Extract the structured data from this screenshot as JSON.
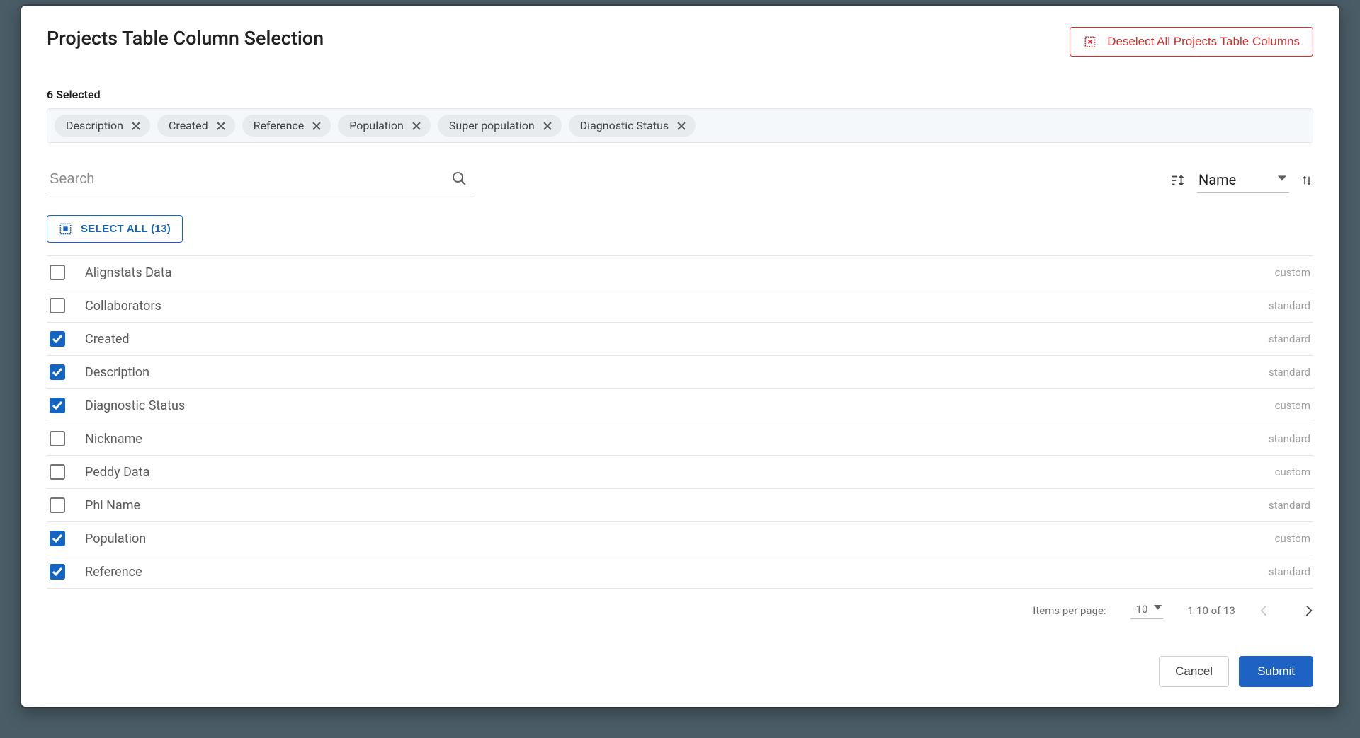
{
  "header": {
    "title": "Projects Table Column Selection",
    "deselect_label": "Deselect All Projects Table Columns"
  },
  "selected": {
    "summary": "6 Selected",
    "chips": [
      "Description",
      "Created",
      "Reference",
      "Population",
      "Super population",
      "Diagnostic Status"
    ]
  },
  "search": {
    "placeholder": "Search"
  },
  "sort": {
    "by": "Name"
  },
  "select_all": {
    "label": "SELECT ALL (13)"
  },
  "rows": [
    {
      "label": "Alignstats Data",
      "type": "custom",
      "checked": false
    },
    {
      "label": "Collaborators",
      "type": "standard",
      "checked": false
    },
    {
      "label": "Created",
      "type": "standard",
      "checked": true
    },
    {
      "label": "Description",
      "type": "standard",
      "checked": true
    },
    {
      "label": "Diagnostic Status",
      "type": "custom",
      "checked": true
    },
    {
      "label": "Nickname",
      "type": "standard",
      "checked": false
    },
    {
      "label": "Peddy Data",
      "type": "custom",
      "checked": false
    },
    {
      "label": "Phi Name",
      "type": "standard",
      "checked": false
    },
    {
      "label": "Population",
      "type": "custom",
      "checked": true
    },
    {
      "label": "Reference",
      "type": "standard",
      "checked": true
    }
  ],
  "paginator": {
    "items_per_page_label": "Items per page:",
    "items_per_page_value": "10",
    "range": "1-10 of 13"
  },
  "actions": {
    "cancel": "Cancel",
    "submit": "Submit"
  }
}
